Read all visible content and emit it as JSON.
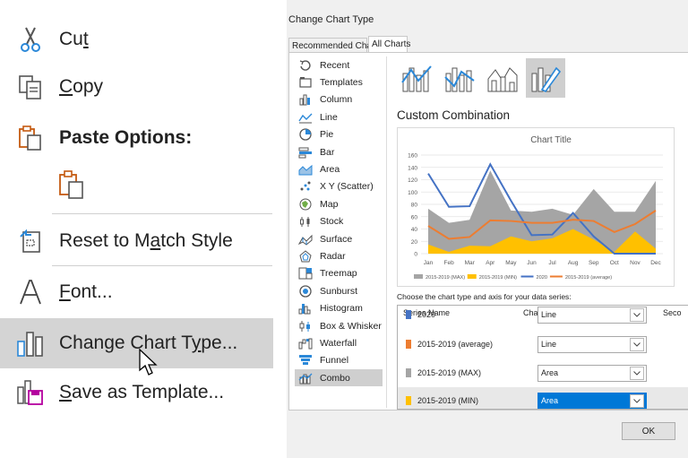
{
  "context_menu": {
    "cut": {
      "pre": "Cu",
      "ul": "t",
      "post": "",
      "icon": "scissors-icon"
    },
    "copy": {
      "pre": "",
      "ul": "C",
      "post": "opy",
      "icon": "copy-icon"
    },
    "paste_options": {
      "label": "Paste Options:",
      "icon": "paste-icon"
    },
    "paste_keep": {
      "icon": "paste-keep-source-icon"
    },
    "reset": {
      "pre": "Reset to M",
      "ul": "a",
      "post": "tch Style",
      "icon": "reset-style-icon"
    },
    "font": {
      "pre": "",
      "ul": "F",
      "post": "ont...",
      "icon": "font-icon"
    },
    "change_chart_type": {
      "pre": "Change Chart T",
      "ul": "y",
      "post": "pe...",
      "icon": "chart-type-icon"
    },
    "save_template": {
      "pre": "",
      "ul": "S",
      "post": "ave as Template...",
      "icon": "save-template-icon"
    }
  },
  "dialog": {
    "title": "Change Chart Type",
    "tabs": [
      "Recommended Charts",
      "All Charts"
    ],
    "chart_types": [
      "Recent",
      "Templates",
      "Column",
      "Line",
      "Pie",
      "Bar",
      "Area",
      "X Y (Scatter)",
      "Map",
      "Stock",
      "Surface",
      "Radar",
      "Treemap",
      "Sunburst",
      "Histogram",
      "Box & Whisker",
      "Waterfall",
      "Funnel",
      "Combo"
    ],
    "selected_type": "Combo",
    "section_title": "Custom Combination",
    "series_caption": "Choose the chart type and axis for your data series:",
    "table_headers": {
      "name": "Series Name",
      "type": "Chart Type",
      "secondary": "Seco"
    },
    "series": [
      {
        "name": "2020",
        "type": "Line",
        "color": "#4472c4"
      },
      {
        "name": "2015-2019 (average)",
        "type": "Line",
        "color": "#ed7d31"
      },
      {
        "name": "2015-2019 (MAX)",
        "type": "Area",
        "color": "#a5a5a5"
      },
      {
        "name": "2015-2019 (MIN)",
        "type": "Area",
        "color": "#ffc000"
      }
    ],
    "ok_label": "OK"
  },
  "chart_data": {
    "type": "area",
    "title": "Chart Title",
    "categories": [
      "Jan",
      "Feb",
      "Mar",
      "Apr",
      "May",
      "Jun",
      "Jul",
      "Aug",
      "Sep",
      "Oct",
      "Nov",
      "Dec"
    ],
    "ylim": [
      0,
      160
    ],
    "yticks": [
      0,
      20,
      40,
      60,
      80,
      100,
      120,
      140,
      160
    ],
    "grid": true,
    "legend_position": "bottom",
    "series": [
      {
        "name": "2015-2019 (MAX)",
        "kind": "area",
        "color": "#a5a5a5",
        "values": [
          73,
          50,
          55,
          135,
          70,
          68,
          73,
          63,
          105,
          68,
          68,
          118
        ]
      },
      {
        "name": "2015-2019 (MIN)",
        "kind": "area",
        "color": "#ffc000",
        "values": [
          15,
          3,
          13,
          12,
          28,
          20,
          25,
          40,
          23,
          3,
          36,
          8
        ]
      },
      {
        "name": "2020",
        "kind": "line",
        "color": "#4472c4",
        "values": [
          130,
          76,
          77,
          145,
          86,
          30,
          31,
          66,
          28,
          0,
          0,
          0
        ]
      },
      {
        "name": "2015-2019 (average)",
        "kind": "line",
        "color": "#ed7d31",
        "values": [
          45,
          24,
          27,
          54,
          53,
          50,
          50,
          55,
          53,
          35,
          48,
          70
        ]
      }
    ]
  }
}
